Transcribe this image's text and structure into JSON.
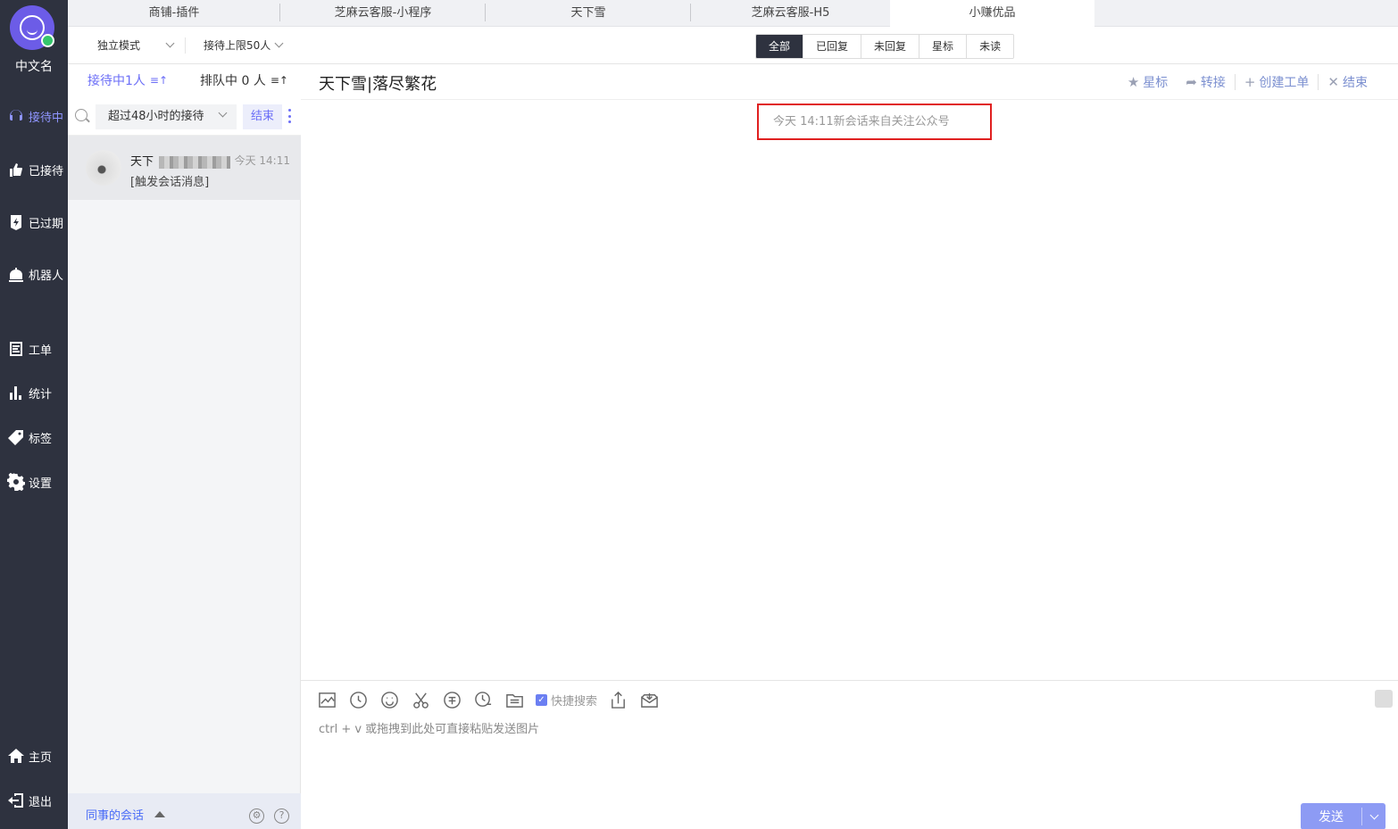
{
  "user": {
    "name": "中文名",
    "avatar_icon": "smile-icon",
    "status_color": "#35c66c"
  },
  "nav": [
    {
      "label": "接待中",
      "icon": "headset-icon",
      "active": true
    },
    {
      "label": "已接待",
      "icon": "hand-icon"
    },
    {
      "label": "已过期",
      "icon": "expired-icon"
    },
    {
      "label": "机器人",
      "icon": "robot-icon"
    },
    {
      "label": "工单",
      "icon": "ticket-icon"
    },
    {
      "label": "统计",
      "icon": "chart-icon"
    },
    {
      "label": "标签",
      "icon": "tag-icon"
    },
    {
      "label": "设置",
      "icon": "gear-icon"
    },
    {
      "label": "主页",
      "icon": "home-icon"
    },
    {
      "label": "退出",
      "icon": "logout-icon"
    }
  ],
  "app_tabs": [
    {
      "label": "商铺-插件"
    },
    {
      "label": "芝麻云客服-小程序"
    },
    {
      "label": "天下雪"
    },
    {
      "label": "芝麻云客服-H5"
    },
    {
      "label": "小赚优品",
      "active": true
    }
  ],
  "toolbar": {
    "mode": "独立模式",
    "limit": "接待上限50人",
    "filters": [
      "全部",
      "已回复",
      "未回复",
      "星标",
      "未读"
    ],
    "active_filter": "全部"
  },
  "list": {
    "tab_active": "接待中1人",
    "tab_queue": "排队中 0 人",
    "sort_glyph": "≡↑",
    "range_select": "超过48小时的接待",
    "end_label": "结束",
    "conversation": {
      "name": "天下",
      "time": "今天 14:11",
      "message": "[触发会话消息]"
    },
    "colleague_label": "同事的会话"
  },
  "chat": {
    "title": "天下雪|落尽繁花",
    "actions": [
      {
        "label": "星标",
        "glyph": "★",
        "icon": "star-icon"
      },
      {
        "label": "转接",
        "glyph": "➦",
        "icon": "transfer-icon"
      },
      {
        "label": "创建工单",
        "glyph": "+",
        "icon": "plus-icon"
      },
      {
        "label": "结束",
        "glyph": "✕",
        "icon": "close-icon"
      }
    ],
    "system_note": "今天 14:11新会话来自关注公众号"
  },
  "composer": {
    "quick_search": "快捷搜索",
    "placeholder": "ctrl + v 或拖拽到此处可直接粘贴发送图片",
    "send_label": "发送"
  },
  "colors": {
    "sidebar_bg": "#2e323f",
    "accent": "#6b6ef7",
    "send_bg": "#8d9bf4",
    "highlight_border": "#e02020"
  }
}
